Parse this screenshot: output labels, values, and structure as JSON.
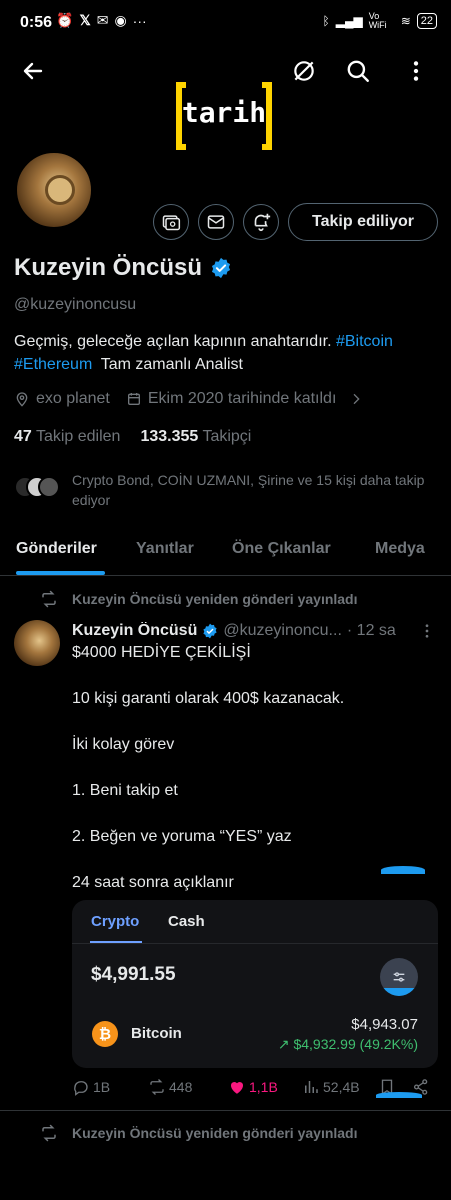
{
  "status_bar": {
    "time": "0:56",
    "network": "Vo WiFi",
    "battery": "22"
  },
  "colors": {
    "background": "#000000",
    "accent": "#1d9bf0",
    "logo_yellow": "#ffd400",
    "like": "#f91880",
    "positive": "#3fbf6f"
  },
  "header": {
    "back_icon": "arrow-left-icon",
    "logo_text": "tarih",
    "actions": [
      "hide-icon",
      "search-icon",
      "more-vertical-icon"
    ]
  },
  "profile": {
    "name": "Kuzeyin Öncüsü",
    "handle": "@kuzeyinoncusu",
    "follow_button": "Takip ediliyor",
    "bio_text": "Geçmiş, geleceğe açılan kapının anahtarıdır.",
    "bio_tag1": "#Bitcoin",
    "bio_tag2": "#Ethereum",
    "bio_suffix": "Tam zamanlı Analist",
    "location": "exo planet",
    "joined": "Ekim 2020 tarihinde katıldı",
    "following_count": "47",
    "following_label": "Takip edilen",
    "followers_count": "133.355",
    "followers_label": "Takipçi",
    "known_followers": "Crypto Bond, COİN UZMANI, Şirine ve 15 kişi daha takip ediyor"
  },
  "tabs": [
    {
      "label": "Gönderiler",
      "active": true
    },
    {
      "label": "Yanıtlar",
      "active": false
    },
    {
      "label": "Öne Çıkanlar",
      "active": false
    },
    {
      "label": "Medya",
      "active": false
    }
  ],
  "post": {
    "repost_label": "Kuzeyin Öncüsü yeniden gönderi yayınladı",
    "author": "Kuzeyin Öncüsü",
    "handle": "@kuzeyinoncu...",
    "time": "· 12 sa",
    "lines": [
      "$4000 HEDİYE ÇEKİLİŞİ",
      "10 kişi garanti olarak 400$ kazanacak.",
      "İki kolay görev",
      "1. Beni takip et",
      "2. Beğen ve yoruma “YES” yaz",
      "24 saat sonra açıklanır"
    ],
    "embed": {
      "tab_crypto": "Crypto",
      "tab_cash": "Cash",
      "balance": "$4,991.55",
      "coin_symbol": "₿",
      "coin_name": "Bitcoin",
      "coin_value": "$4,943.07",
      "coin_change": "↗ $4,932.99 (49.2K%)"
    },
    "actions": {
      "replies": "1B",
      "reposts": "448",
      "likes": "1,1B",
      "views": "52,4B"
    }
  },
  "next_post": {
    "repost_label": "Kuzeyin Öncüsü yeniden gönderi yayınladı"
  }
}
